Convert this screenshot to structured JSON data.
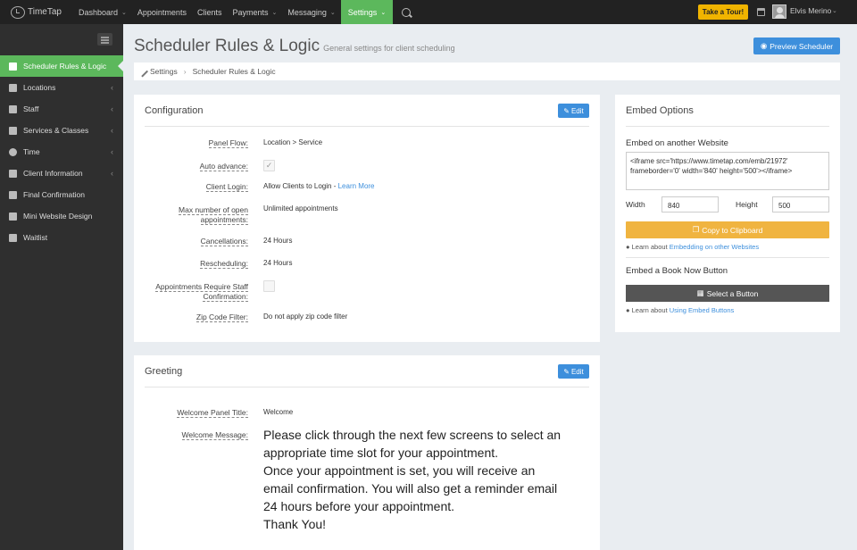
{
  "brand": {
    "logo_text": "TimeTap"
  },
  "topnav": {
    "items": [
      {
        "label": "Dashboard",
        "dropdown": true
      },
      {
        "label": "Appointments",
        "dropdown": false
      },
      {
        "label": "Clients",
        "dropdown": false
      },
      {
        "label": "Payments",
        "dropdown": true
      },
      {
        "label": "Messaging",
        "dropdown": true
      },
      {
        "label": "Settings",
        "dropdown": true,
        "active": true
      }
    ],
    "tour_label": "Take a Tour!",
    "user_name": "Elvis Merino",
    "accent": "#5cb85c"
  },
  "sidebar": {
    "items": [
      {
        "label": "Scheduler Rules & Logic",
        "icon": "wrench-icon",
        "active": true
      },
      {
        "label": "Locations",
        "icon": "building-icon"
      },
      {
        "label": "Staff",
        "icon": "users-icon"
      },
      {
        "label": "Services & Classes",
        "icon": "list-icon"
      },
      {
        "label": "Time",
        "icon": "clock-icon"
      },
      {
        "label": "Client Information",
        "icon": "id-card-icon"
      },
      {
        "label": "Final Confirmation",
        "icon": "check-square-icon"
      },
      {
        "label": "Mini Website Design",
        "icon": "pencil-icon"
      },
      {
        "label": "Waitlist",
        "icon": "list-alt-icon"
      }
    ]
  },
  "header": {
    "title": "Scheduler Rules & Logic",
    "subtitle": "General settings for client scheduling",
    "preview_label": "Preview Scheduler"
  },
  "breadcrumb": {
    "root": "Settings",
    "current": "Scheduler Rules & Logic"
  },
  "configuration": {
    "title": "Configuration",
    "edit_label": "Edit",
    "panel_flow": {
      "label": "Panel Flow:",
      "value": "Location > Service"
    },
    "auto_advance": {
      "label": "Auto advance:",
      "checked": true
    },
    "client_login": {
      "label": "Client Login:",
      "value": "Allow Clients to Login - ",
      "link": "Learn More"
    },
    "max_open": {
      "label_line1": "Max number of open",
      "label_line2": "appointments:",
      "value": "Unlimited appointments"
    },
    "cancellations": {
      "label": "Cancellations:",
      "value": "24 Hours"
    },
    "rescheduling": {
      "label": "Rescheduling:",
      "value": "24 Hours"
    },
    "staff_confirm": {
      "label_line1": "Appointments Require Staff",
      "label_line2": "Confirmation:",
      "checked": false
    },
    "zip_filter": {
      "label": "Zip Code Filter:",
      "value": "Do not apply zip code filter"
    }
  },
  "greeting": {
    "title": "Greeting",
    "edit_label": "Edit",
    "panel_title_label": "Welcome Panel Title:",
    "panel_title_value": "Welcome",
    "message_label": "Welcome Message:",
    "message_lines": [
      "Please click through the next few screens to select an",
      "appropriate time slot for your appointment.",
      "Once your appointment is set, you will receive an",
      "email confirmation. You will also get a reminder email",
      "24 hours before your appointment.",
      "Thank You!"
    ]
  },
  "embed": {
    "title": "Embed Options",
    "website_label": "Embed on another Website",
    "code": "<iframe src='https://www.timetap.com/emb/21972' frameborder='0' width='840' height='500'></iframe>",
    "width_label": "Width",
    "width_value": "840",
    "height_label": "Height",
    "height_value": "500",
    "copy_label": "Copy to Clipboard",
    "learn1_prefix": "Learn about ",
    "learn1_link": "Embedding on other Websites",
    "book_label": "Embed a Book Now Button",
    "select_label": "Select a Button",
    "learn2_prefix": "Learn about ",
    "learn2_link": "Using Embed Buttons"
  }
}
